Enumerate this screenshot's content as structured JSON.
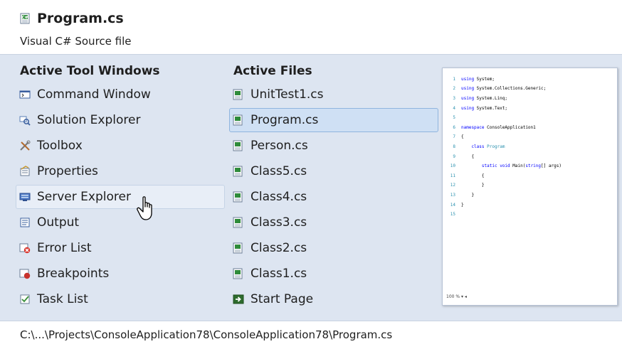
{
  "header": {
    "file_title": "Program.cs",
    "file_type": "Visual C# Source file"
  },
  "tool_windows": {
    "heading": "Active Tool Windows",
    "items": [
      {
        "label": "Command Window",
        "icon": "command-window-icon"
      },
      {
        "label": "Solution Explorer",
        "icon": "solution-explorer-icon"
      },
      {
        "label": "Toolbox",
        "icon": "toolbox-icon"
      },
      {
        "label": "Properties",
        "icon": "properties-icon"
      },
      {
        "label": "Server Explorer",
        "icon": "server-explorer-icon"
      },
      {
        "label": "Output",
        "icon": "output-icon"
      },
      {
        "label": "Error List",
        "icon": "error-list-icon"
      },
      {
        "label": "Breakpoints",
        "icon": "breakpoints-icon"
      },
      {
        "label": "Task List",
        "icon": "task-list-icon"
      }
    ]
  },
  "active_files": {
    "heading": "Active Files",
    "items": [
      {
        "label": "UnitTest1.cs",
        "icon": "csharp-file-icon"
      },
      {
        "label": "Program.cs",
        "icon": "csharp-file-icon"
      },
      {
        "label": "Person.cs",
        "icon": "csharp-file-icon"
      },
      {
        "label": "Class5.cs",
        "icon": "csharp-file-icon"
      },
      {
        "label": "Class4.cs",
        "icon": "csharp-file-icon"
      },
      {
        "label": "Class3.cs",
        "icon": "csharp-file-icon"
      },
      {
        "label": "Class2.cs",
        "icon": "csharp-file-icon"
      },
      {
        "label": "Class1.cs",
        "icon": "csharp-file-icon"
      },
      {
        "label": "Start Page",
        "icon": "start-page-icon"
      }
    ]
  },
  "preview": {
    "lines": [
      {
        "n": "1",
        "code": "using System;"
      },
      {
        "n": "2",
        "code": "using System.Collections.Generic;"
      },
      {
        "n": "3",
        "code": "using System.Linq;"
      },
      {
        "n": "4",
        "code": "using System.Text;"
      },
      {
        "n": "5",
        "code": ""
      },
      {
        "n": "6",
        "code": "namespace ConsoleApplication1"
      },
      {
        "n": "7",
        "code": "{"
      },
      {
        "n": "8",
        "code": "    class Program"
      },
      {
        "n": "9",
        "code": "    {"
      },
      {
        "n": "10",
        "code": "        static void Main(string[] args)"
      },
      {
        "n": "11",
        "code": "        {"
      },
      {
        "n": "12",
        "code": "        }"
      },
      {
        "n": "13",
        "code": "    }"
      },
      {
        "n": "14",
        "code": "}"
      },
      {
        "n": "15",
        "code": ""
      }
    ],
    "zoom": "100 %"
  },
  "footer": {
    "path": "C:\\...\\Projects\\ConsoleApplication78\\ConsoleApplication78\\Program.cs"
  },
  "colors": {
    "panel": "#dde5f1",
    "selected": "#cfe0f4",
    "selected_border": "#8fb4de",
    "keyword": "#0000ff",
    "type": "#2b91af"
  },
  "state": {
    "selected_file": "Program.cs",
    "hovered_tool_window": "Server Explorer"
  }
}
